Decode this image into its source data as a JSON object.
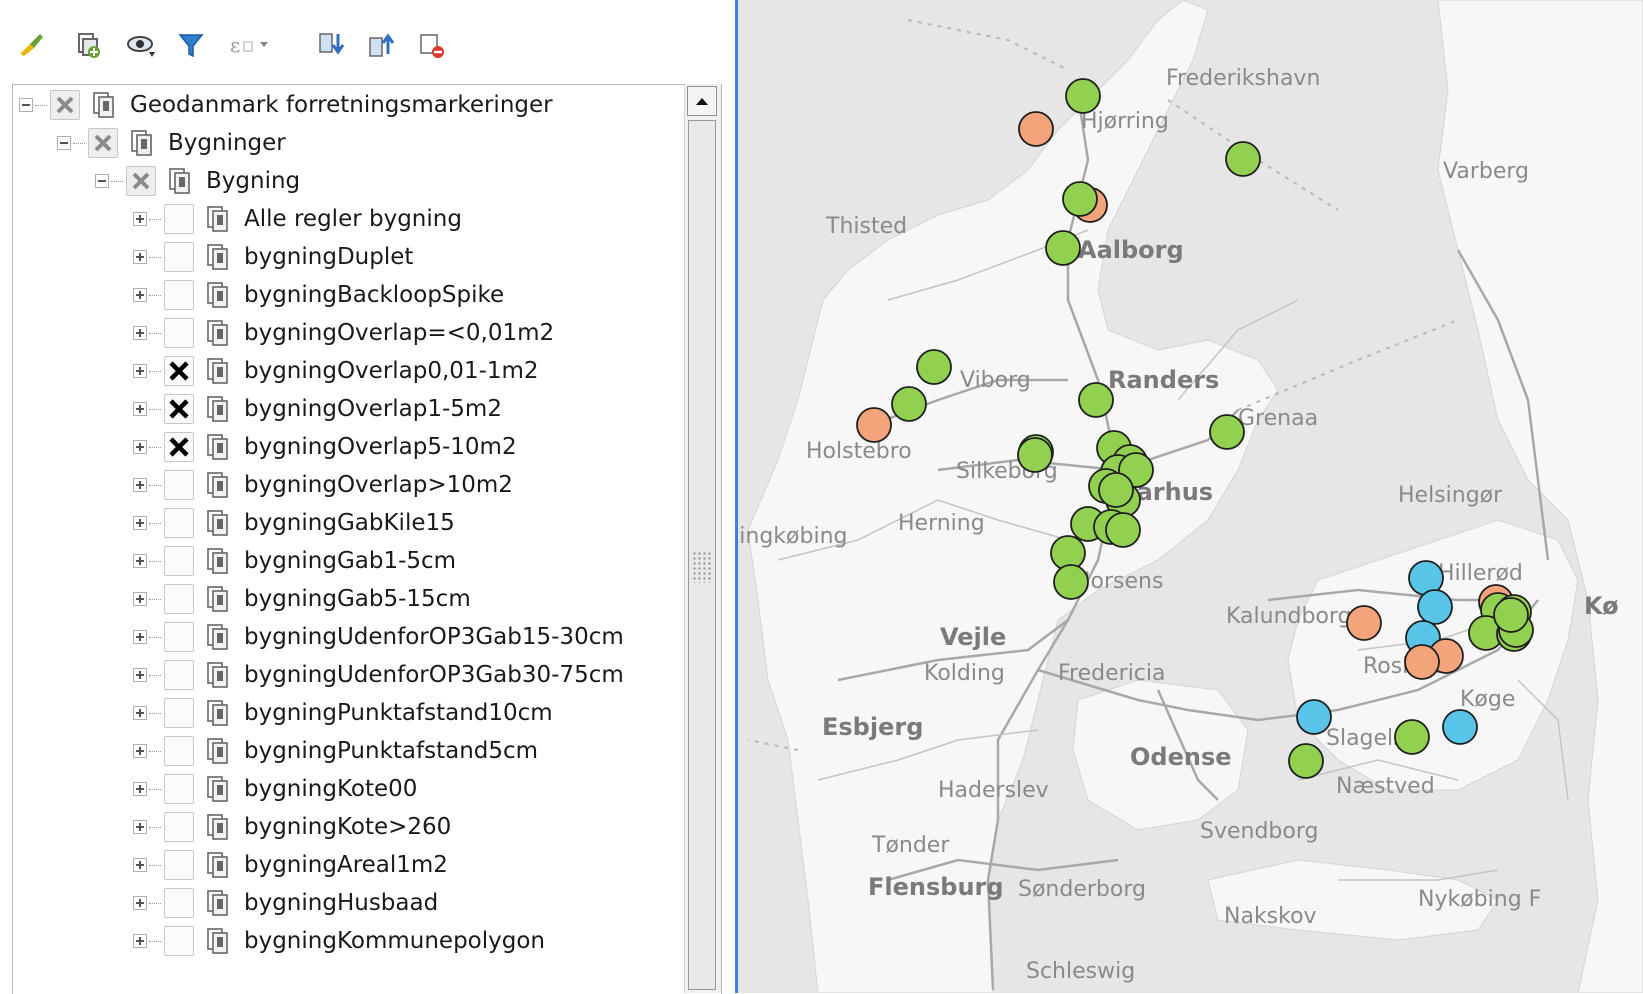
{
  "toolbar": {
    "buttons": [
      {
        "icon": "paintbrush-icon",
        "name": "style-manager-button"
      },
      {
        "icon": "add-group-icon",
        "name": "add-group-button"
      },
      {
        "icon": "eye-icon",
        "name": "visibility-button"
      },
      {
        "icon": "filter-icon",
        "name": "filter-legend-button"
      },
      {
        "icon": "expression-filter-icon",
        "name": "expression-filter-button"
      },
      {
        "icon": "expand-all-icon",
        "name": "expand-all-button"
      },
      {
        "icon": "collapse-all-icon",
        "name": "collapse-all-button"
      },
      {
        "icon": "remove-layer-icon",
        "name": "remove-layer-button"
      }
    ]
  },
  "layers": {
    "root": "Geodanmark forretningsmarkeringer",
    "group": "Bygninger",
    "subgroup": "Bygning",
    "items": [
      {
        "label": "Alle regler bygning",
        "checked": false
      },
      {
        "label": "bygningDuplet",
        "checked": false
      },
      {
        "label": "bygningBackloopSpike",
        "checked": false
      },
      {
        "label": "bygningOverlap=<0,01m2",
        "checked": false
      },
      {
        "label": "bygningOverlap0,01-1m2",
        "checked": true
      },
      {
        "label": "bygningOverlap1-5m2",
        "checked": true
      },
      {
        "label": "bygningOverlap5-10m2",
        "checked": true
      },
      {
        "label": "bygningOverlap>10m2",
        "checked": false
      },
      {
        "label": "bygningGabKile15",
        "checked": false
      },
      {
        "label": "bygningGab1-5cm",
        "checked": false
      },
      {
        "label": "bygningGab5-15cm",
        "checked": false
      },
      {
        "label": "bygningUdenforOP3Gab15-30cm",
        "checked": false
      },
      {
        "label": "bygningUdenforOP3Gab30-75cm",
        "checked": false
      },
      {
        "label": "bygningPunktafstand10cm",
        "checked": false
      },
      {
        "label": "bygningPunktafstand5cm",
        "checked": false
      },
      {
        "label": "bygningKote00",
        "checked": false
      },
      {
        "label": "bygningKote>260",
        "checked": false
      },
      {
        "label": "bygningAreal1m2",
        "checked": false
      },
      {
        "label": "bygningHusbaad",
        "checked": false
      },
      {
        "label": "bygningKommunepolygon",
        "checked": false
      }
    ]
  },
  "map": {
    "places": {
      "frederikshavn": "Frederikshavn",
      "hjorring": "Hjørring",
      "varberg": "Varberg",
      "thisted": "Thisted",
      "aalborg": "Aalborg",
      "viborg": "Viborg",
      "randers": "Randers",
      "grenaa": "Grenaa",
      "holstebro": "Holstebro",
      "silkeborg": "Silkeborg",
      "aarhus": "Aarhus",
      "helsingor": "Helsingør",
      "ringkobing": "Ringkøbing",
      "herning": "Herning",
      "horsens": "Horsens",
      "kalundborg": "Kalundborg",
      "hillerod": "Hillerød",
      "vejle": "Vejle",
      "kolding": "Kolding",
      "fredericia": "Fredericia",
      "roskilde": "Roskilde",
      "koge": "Køge",
      "esbjerg": "Esbjerg",
      "odense": "Odense",
      "slagelse": "Slagelse",
      "naestved": "Næstved",
      "haderslev": "Haderslev",
      "svendborg": "Svendborg",
      "tonder": "Tønder",
      "flensburg": "Flensburg",
      "sonderborg": "Sønderborg",
      "nakskov": "Nakskov",
      "nykobing": "Nykøbing F",
      "schleswig": "Schleswig",
      "kobenhavn": "Kø"
    },
    "colors": {
      "green": "#92d050",
      "orange": "#f4a47a",
      "blue": "#58c4e8"
    }
  }
}
